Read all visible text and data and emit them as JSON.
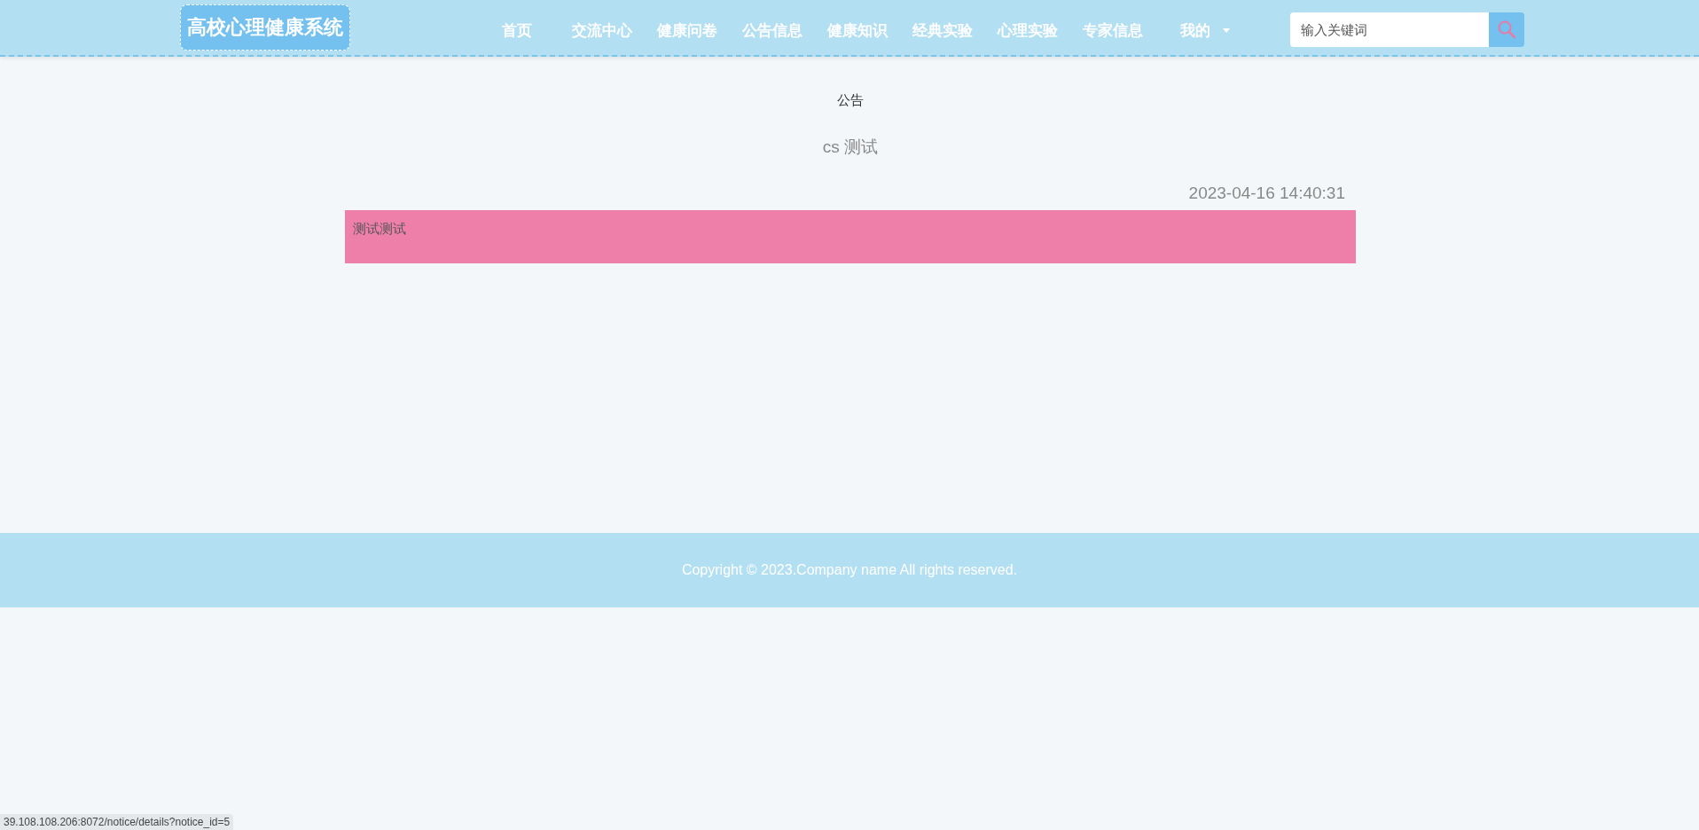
{
  "header": {
    "logo": "高校心理健康系统",
    "nav": [
      {
        "label": "首页",
        "selected": false
      },
      {
        "label": "交流中心",
        "selected": false
      },
      {
        "label": "健康问卷",
        "selected": false
      },
      {
        "label": "公告信息",
        "selected": false
      },
      {
        "label": "健康知识",
        "selected": false
      },
      {
        "label": "经典实验",
        "selected": false
      },
      {
        "label": "心理实验",
        "selected": false
      },
      {
        "label": "专家信息",
        "selected": false
      }
    ],
    "user_menu": "我的",
    "search": {
      "placeholder": "输入关键词"
    }
  },
  "notice": {
    "heading": "公告",
    "title": "cs 测试",
    "date": "2023-04-16 14:40:31",
    "body": "测试测试"
  },
  "footer": {
    "copyright": "Copyright © 2023.Company name All rights reserved."
  },
  "status_bar": {
    "url": "39.108.108.206:8072/notice/details?notice_id=5"
  }
}
